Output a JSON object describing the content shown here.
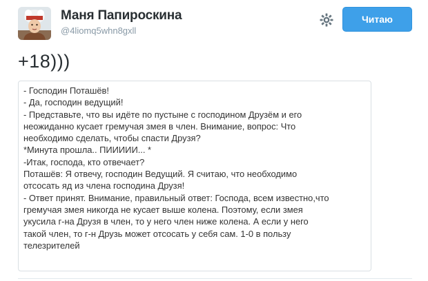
{
  "user": {
    "display_name": "Маня Папироскина",
    "username": "@4liomq5whn8gxll"
  },
  "actions": {
    "settings_icon": "gear-icon",
    "follow_label": "Читаю"
  },
  "tweet": {
    "text": "+18)))"
  },
  "image_text": {
    "lines": [
      "- Господин Поташёв!",
      "- Да, господин ведущий!",
      "- Представьте, что вы идёте по пустыне с господином Друзём и его",
      "неожиданно кусает гремучая змея в член. Внимание, вопрос: Что",
      "необходимо сделать, чтобы спасти Друзя?",
      "*Минута прошла.. ПИИИИИ... *",
      "-Итак, господа, кто отвечает?",
      "Поташёв: Я отвечу, господин Ведущий. Я считаю, что необходимо",
      "отсосать яд из члена господина Друзя!",
      "- Ответ принят. Внимание, правильный ответ: Господа, всем известно,что",
      "гремучая змея никогда не кусает выше колена. Поэтому, если змея",
      "укусила г-на Друзя в член, то у него член ниже колена. А если у него",
      "такой член, то г-н Друзь может отсосать у себя сам. 1-0 в пользу",
      "телезрителей"
    ]
  },
  "colors": {
    "follow_button": "#3ea0e9",
    "username": "#8899a6",
    "text": "#292f33",
    "card_border": "#d9dfe3"
  }
}
